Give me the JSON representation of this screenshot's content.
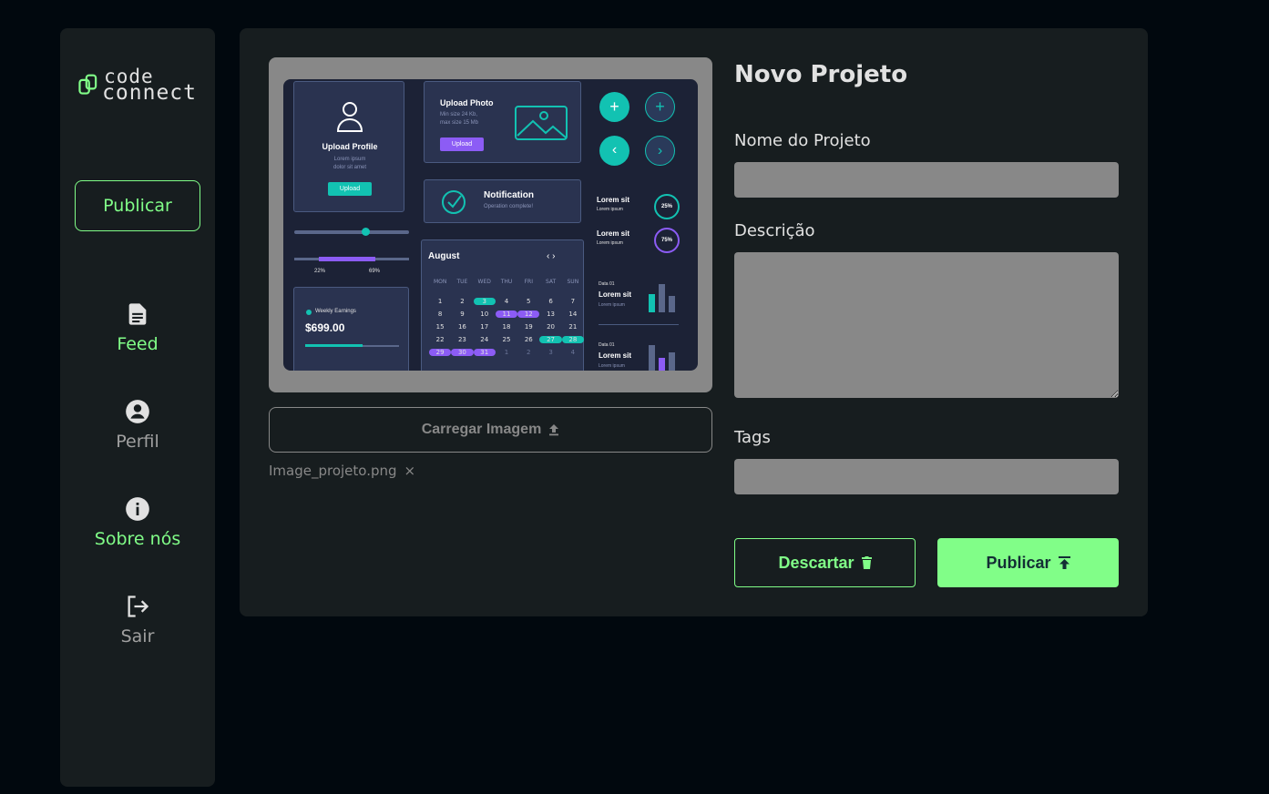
{
  "brand": {
    "logo_line1": "code",
    "logo_line2": "connect"
  },
  "sidebar": {
    "publish_label": "Publicar",
    "items": [
      {
        "label": "Feed",
        "icon": "document-icon",
        "active": true
      },
      {
        "label": "Perfil",
        "icon": "account-circle-icon",
        "active": false
      },
      {
        "label": "Sobre nós",
        "icon": "info-icon",
        "active": true
      },
      {
        "label": "Sair",
        "icon": "logout-icon",
        "active": false
      }
    ]
  },
  "upload": {
    "button_label": "Carregar Imagem",
    "file_name": "Image_projeto.png",
    "remove_symbol": "×"
  },
  "preview": {
    "upload_profile": "Upload Profile",
    "upload_profile_sub1": "Lorem ipsum",
    "upload_profile_sub2": "dolor sit amet",
    "upload_btn": "Upload",
    "upload_photo": "Upload Photo",
    "min_size": "Min size 24 Kb,",
    "max_size": "max size 15 Mb",
    "notification": "Notification",
    "operation": "Operation complete!",
    "slider_a": "22%",
    "slider_b": "69%",
    "weekly": "Weekly Earnings",
    "earnings": "$699.00",
    "month": "August",
    "weekdays": [
      "MON",
      "TUE",
      "WED",
      "THU",
      "FRI",
      "SAT",
      "SUN"
    ],
    "days": [
      "1",
      "2",
      "3",
      "4",
      "5",
      "6",
      "7",
      "8",
      "9",
      "10",
      "11",
      "12",
      "13",
      "14",
      "15",
      "16",
      "17",
      "18",
      "19",
      "20",
      "21",
      "22",
      "23",
      "24",
      "25",
      "26",
      "27",
      "28",
      "29",
      "30",
      "31",
      "1",
      "2",
      "3",
      "4"
    ],
    "lorem_sit": "Lorem sit",
    "lorem_ipsum": "Lorem ipsum",
    "pct25": "25%",
    "pct75": "75%",
    "data01": "Data 01"
  },
  "form": {
    "title": "Novo Projeto",
    "name_label": "Nome do Projeto",
    "name_value": "",
    "desc_label": "Descrição",
    "desc_value": "",
    "tags_label": "Tags",
    "tags_value": "",
    "discard_label": "Descartar",
    "publish_label": "Publicar"
  },
  "colors": {
    "accent": "#81fe88",
    "background": "#01080e",
    "surface": "#171d1f",
    "field": "#888888"
  }
}
